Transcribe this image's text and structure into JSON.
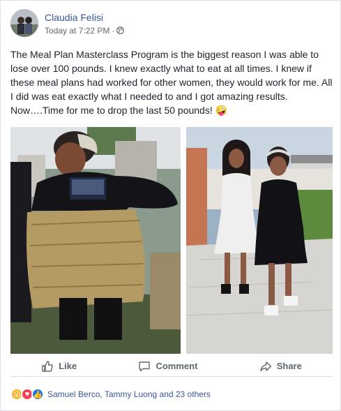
{
  "post": {
    "author": "Claudia Felisi",
    "timestamp": "Today at 7:22 PM",
    "separator": "·",
    "privacy_icon": "globe-icon",
    "text": "The Meal Plan Masterclass Program is the biggest reason I was able to lose over 100 pounds. I knew exactly what to eat at all times. I knew if these meal plans had worked for other women, they would work for me. All I did was eat exactly what I needed to and I got amazing results. Now….Time for me to drop the last 50 pounds! 🤪",
    "photos": [
      {
        "icon": "before-photo"
      },
      {
        "icon": "after-photo"
      }
    ]
  },
  "actions": {
    "like": "Like",
    "comment": "Comment",
    "share": "Share"
  },
  "reactions": {
    "icons": [
      "wow-icon",
      "love-icon",
      "like-icon"
    ],
    "wow_glyph": "😮",
    "love_glyph": "♥",
    "like_glyph": "👍",
    "names": "Samuel Berco, Tammy Luong and 23 others"
  },
  "colors": {
    "link": "#385898",
    "muted": "#606770",
    "like_blue": "#1877f2",
    "love_red": "#f33e58",
    "wow_yellow": "#f7b125"
  }
}
